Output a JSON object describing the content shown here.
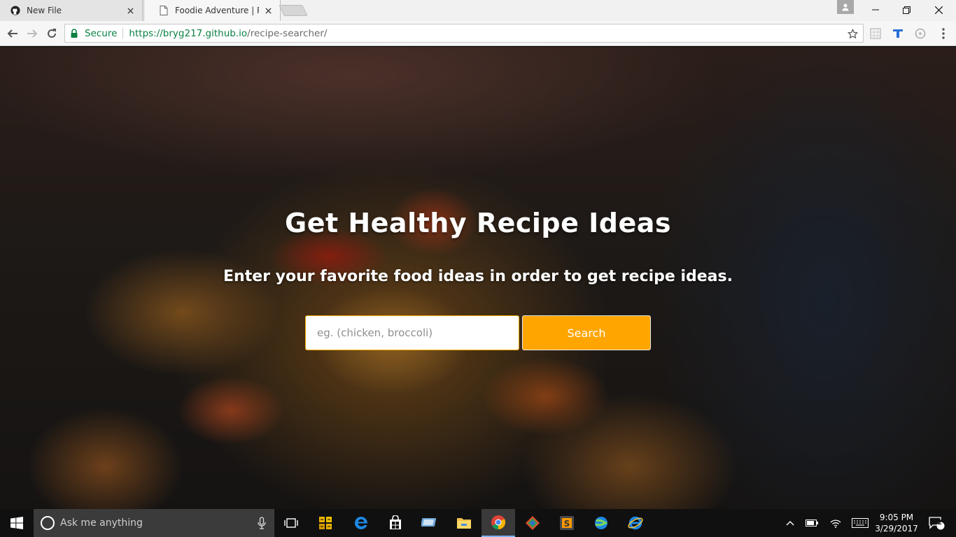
{
  "browser": {
    "tabs": [
      {
        "title": "New File",
        "active": false
      },
      {
        "title": "Foodie Adventure | Recip",
        "active": true
      }
    ],
    "omnibox": {
      "security_label": "Secure",
      "url_scheme_host": "https://bryg217.github.io",
      "url_path": "/recipe-searcher/"
    }
  },
  "hero": {
    "title": "Get Healthy Recipe Ideas",
    "subtitle": "Enter your favorite food ideas in order to get recipe ideas.",
    "search_placeholder": "eg. (chicken, broccoli)",
    "search_value": "",
    "search_button_label": "Search"
  },
  "colors": {
    "accent": "#ffa500",
    "secure_green": "#0b8043"
  },
  "taskbar": {
    "search_placeholder": "Ask me anything",
    "apps": [
      "task-view",
      "winrar",
      "edge",
      "store",
      "remote-desktop",
      "file-explorer",
      "chrome",
      "git",
      "sublime-text",
      "edge-alt",
      "internet-explorer"
    ],
    "clock_time": "9:05 PM",
    "clock_date": "3/29/2017",
    "notification_count": "2"
  }
}
